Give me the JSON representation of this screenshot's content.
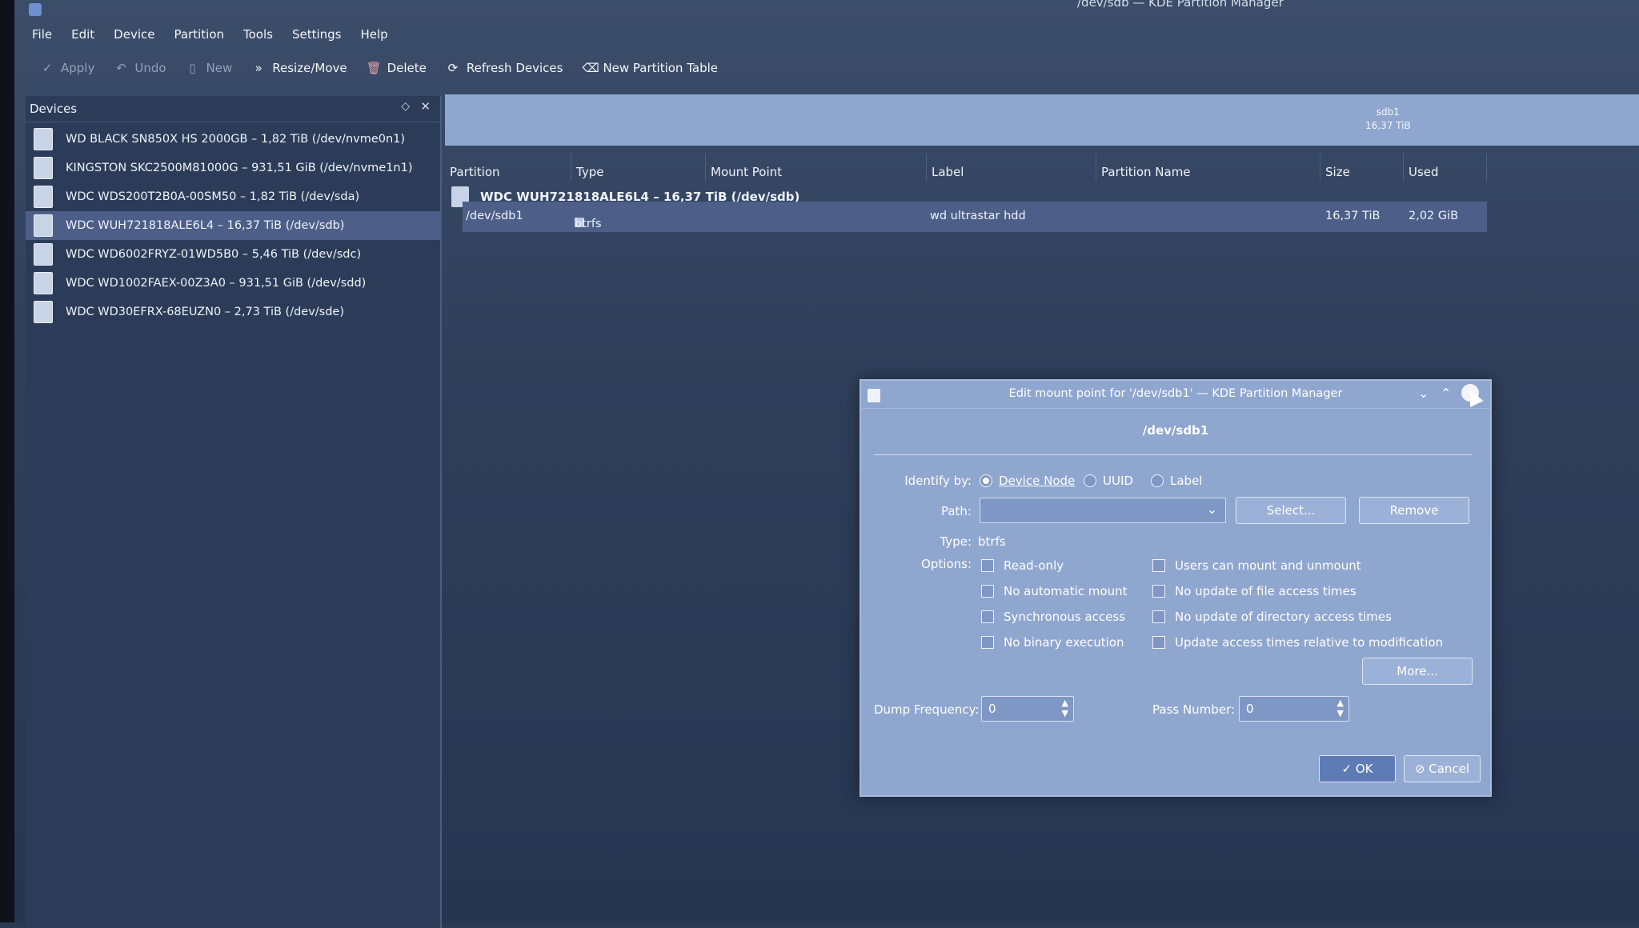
{
  "window": {
    "title": "/dev/sdb — KDE Partition Manager"
  },
  "menu": [
    "File",
    "Edit",
    "Device",
    "Partition",
    "Tools",
    "Settings",
    "Help"
  ],
  "toolbar": {
    "apply": "Apply",
    "undo": "Undo",
    "new": "New",
    "resize_move": "Resize/Move",
    "delete": "Delete",
    "refresh": "Refresh Devices",
    "new_table": "New Partition Table"
  },
  "devices": {
    "title": "Devices",
    "items": [
      "WD BLACK SN850X HS 2000GB – 1,82 TiB (/dev/nvme0n1)",
      "KINGSTON SKC2500M81000G – 931,51 GiB (/dev/nvme1n1)",
      "WDC WDS200T2B0A-00SM50 – 1,82 TiB (/dev/sda)",
      "WDC WUH721818ALE6L4 – 16,37 TiB (/dev/sdb)",
      "WDC WD6002FRYZ-01WD5B0 – 5,46 TiB (/dev/sdc)",
      "WDC WD1002FAEX-00Z3A0 – 931,51 GiB (/dev/sdd)",
      "WDC WD30EFRX-68EUZN0 – 2,73 TiB (/dev/sde)"
    ],
    "selected_index": 3
  },
  "partition_bar": {
    "name": "sdb1",
    "size": "16,37 TiB"
  },
  "table": {
    "headers": [
      "Partition",
      "Type",
      "Mount Point",
      "Label",
      "Partition Name",
      "Size",
      "Used"
    ],
    "device_row": "WDC WUH721818ALE6L4 – 16,37 TiB (/dev/sdb)",
    "rows": [
      {
        "partition": "/dev/sdb1",
        "type": "btrfs",
        "mount": "",
        "label": "wd ultrastar hdd",
        "name": "",
        "size": "16,37 TiB",
        "used": "2,02 GiB"
      }
    ]
  },
  "dialog": {
    "title": "Edit mount point for '/dev/sdb1' — KDE Partition Manager",
    "heading": "/dev/sdb1",
    "identify_label": "Identify by:",
    "identify_options": [
      "Device Node",
      "UUID",
      "Label"
    ],
    "identify_selected": "Device Node",
    "path_label": "Path:",
    "path_value": "",
    "select_button": "Select...",
    "remove_button": "Remove",
    "type_label": "Type:",
    "type_value": "btrfs",
    "options_label": "Options:",
    "options_left": [
      "Read-only",
      "No automatic mount",
      "Synchronous access",
      "No binary execution"
    ],
    "options_right": [
      "Users can mount and unmount",
      "No update of file access times",
      "No update of directory access times",
      "Update access times relative to modification"
    ],
    "more_button": "More...",
    "dump_label": "Dump Frequency:",
    "dump_value": "0",
    "pass_label": "Pass Number:",
    "pass_value": "0",
    "ok_button": "OK",
    "cancel_button": "Cancel"
  }
}
